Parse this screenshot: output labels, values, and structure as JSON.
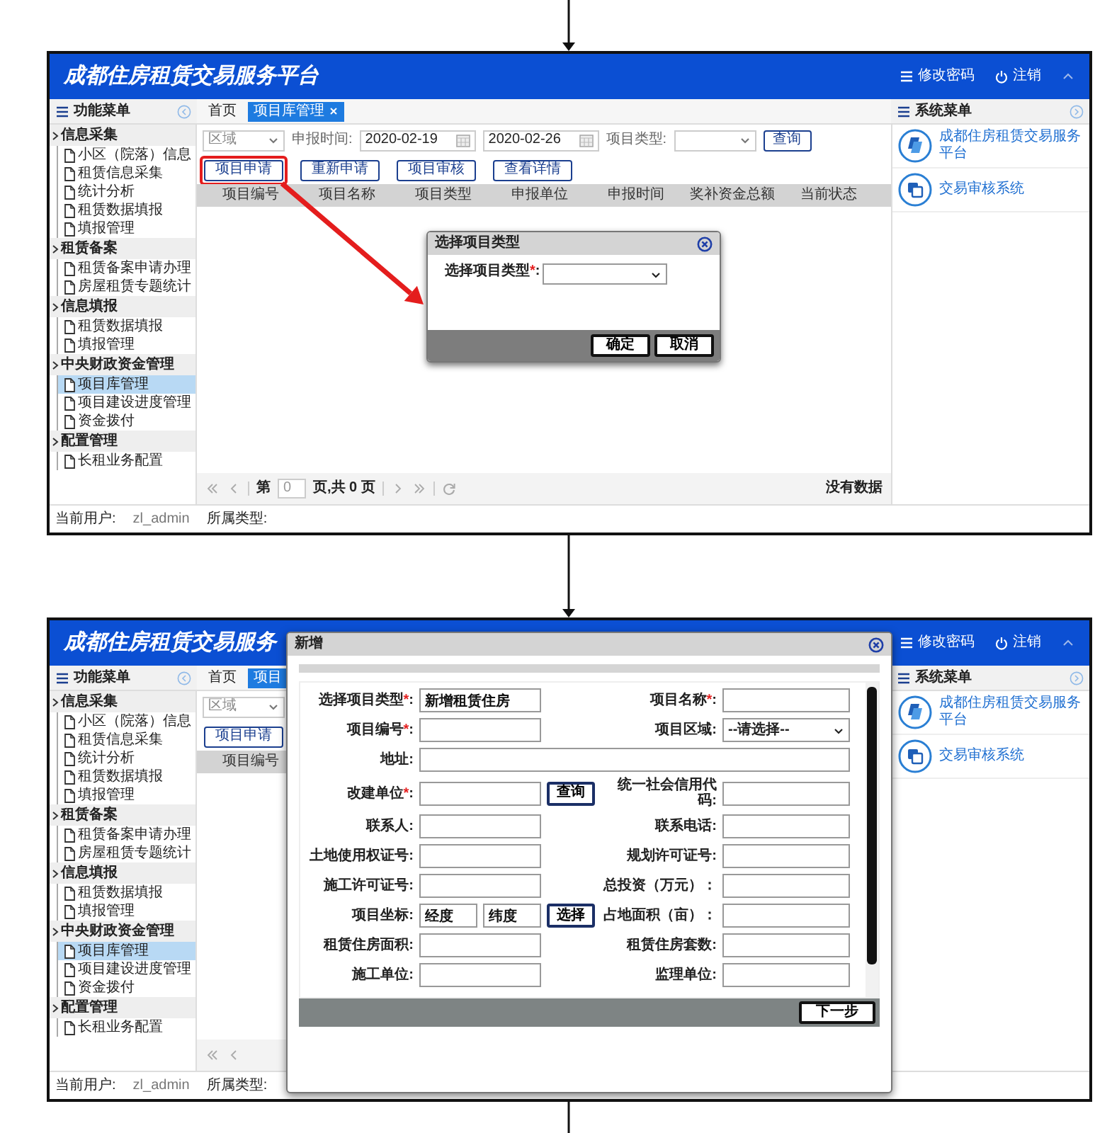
{
  "screens": [
    {
      "header": {
        "title": "成都住房租赁交易服务平台",
        "links": [
          {
            "kind": "password",
            "label": "修改密码"
          },
          {
            "kind": "logout",
            "label": "注销"
          }
        ]
      },
      "function_menu": {
        "title": "功能菜单"
      },
      "tabs": [
        {
          "label": "首页",
          "selected": false
        },
        {
          "label": "项目库管理",
          "selected": true,
          "closable": true
        }
      ],
      "system_menu": {
        "title": "系统菜单",
        "items": [
          {
            "kind": "platform",
            "label": "成都住房租赁交易服务平台"
          },
          {
            "kind": "review",
            "label": "交易审核系统"
          }
        ]
      },
      "sidebar": [
        {
          "label": "信息采集",
          "children": [
            {
              "label": "小区（院落）信息",
              "selected": false
            },
            {
              "label": "租赁信息采集",
              "selected": false
            },
            {
              "label": "统计分析",
              "selected": false
            },
            {
              "label": "租赁数据填报",
              "selected": false
            },
            {
              "label": "填报管理",
              "selected": false
            }
          ]
        },
        {
          "label": "租赁备案",
          "children": [
            {
              "label": "租赁备案申请办理",
              "selected": false
            },
            {
              "label": "房屋租赁专题统计",
              "selected": false
            }
          ]
        },
        {
          "label": "信息填报",
          "children": [
            {
              "label": "租赁数据填报",
              "selected": false
            },
            {
              "label": "填报管理",
              "selected": false
            }
          ]
        },
        {
          "label": "中央财政资金管理",
          "children": [
            {
              "label": "项目库管理",
              "selected": true
            },
            {
              "label": "项目建设进度管理",
              "selected": false
            },
            {
              "label": "资金拨付",
              "selected": false
            }
          ]
        },
        {
          "label": "配置管理",
          "children": [
            {
              "label": "长租业务配置",
              "selected": false
            }
          ]
        }
      ],
      "filters": [
        {
          "kind": "select",
          "placeholder": "区域"
        },
        {
          "kind": "label",
          "text": "申报时间:"
        },
        {
          "kind": "date",
          "value": "2020-02-19"
        },
        {
          "kind": "date",
          "value": "2020-02-26"
        },
        {
          "kind": "label",
          "text": "项目类型:"
        },
        {
          "kind": "select"
        },
        {
          "kind": "button",
          "text": "查询"
        }
      ],
      "actions": [
        {
          "label": "项目申请",
          "highlighted": true
        },
        {
          "label": "重新申请",
          "highlighted": false
        },
        {
          "label": "项目审核",
          "highlighted": false
        },
        {
          "label": "查看详情",
          "highlighted": false
        }
      ],
      "table": {
        "columns": [
          "项目编号",
          "项目名称",
          "项目类型",
          "申报单位",
          "申报时间",
          "奖补资金总额",
          "当前状态"
        ]
      },
      "pager": {
        "page_label": "第",
        "page": "0",
        "total": "页,共 0 页",
        "message": "没有数据"
      },
      "status_bar": {
        "user_label": "当前用户:",
        "user": "zl_admin",
        "type_label": "所属类型:"
      },
      "dialog": {
        "kind": "choice",
        "title": "选择项目类型",
        "label": "选择项目类型",
        "required_mark": "*",
        "label_end": ":",
        "buttons": [
          "确定",
          "取消"
        ]
      }
    },
    {
      "header": {
        "title": "成都住房租赁交易服务",
        "links": [
          {
            "kind": "password",
            "label": "修改密码"
          },
          {
            "kind": "logout",
            "label": "注销"
          }
        ]
      },
      "function_menu": {
        "title": "功能菜单"
      },
      "tabs": [
        {
          "label": "首页",
          "selected": false
        },
        {
          "label": "项目",
          "selected": true
        }
      ],
      "system_menu": {
        "title": "系统菜单",
        "items": [
          {
            "kind": "platform",
            "label": "成都住房租赁交易服务平台"
          },
          {
            "kind": "review",
            "label": "交易审核系统"
          }
        ]
      },
      "sidebar": [
        {
          "label": "信息采集",
          "children": [
            {
              "label": "小区（院落）信息",
              "selected": false
            },
            {
              "label": "租赁信息采集",
              "selected": false
            },
            {
              "label": "统计分析",
              "selected": false
            },
            {
              "label": "租赁数据填报",
              "selected": false
            },
            {
              "label": "填报管理",
              "selected": false
            }
          ]
        },
        {
          "label": "租赁备案",
          "children": [
            {
              "label": "租赁备案申请办理",
              "selected": false
            },
            {
              "label": "房屋租赁专题统计",
              "selected": false
            }
          ]
        },
        {
          "label": "信息填报",
          "children": [
            {
              "label": "租赁数据填报",
              "selected": false
            },
            {
              "label": "填报管理",
              "selected": false
            }
          ]
        },
        {
          "label": "中央财政资金管理",
          "children": [
            {
              "label": "项目库管理",
              "selected": true
            },
            {
              "label": "项目建设进度管理",
              "selected": false
            },
            {
              "label": "资金拨付",
              "selected": false
            }
          ]
        },
        {
          "label": "配置管理",
          "children": [
            {
              "label": "长租业务配置",
              "selected": false
            }
          ]
        }
      ],
      "filters": [
        {
          "kind": "select",
          "placeholder": "区域"
        }
      ],
      "actions": [
        {
          "label": "项目申请",
          "highlighted": false
        }
      ],
      "table": {
        "columns": [
          "项目编号"
        ]
      },
      "status_bar": {
        "user_label": "当前用户:",
        "user": "zl_admin",
        "type_label": "所属类型:"
      },
      "dialog": {
        "kind": "form",
        "title": "新增",
        "buttons": [
          "下一步"
        ],
        "rows": [
          [
            {
              "kind": "text",
              "label": "选择项目类型",
              "required_mark": "*",
              "label_end": ":",
              "value": "新增租赁住房"
            },
            {
              "kind": "text",
              "label": "项目名称",
              "required_mark": "*",
              "label_end": ":"
            }
          ],
          [
            {
              "kind": "text",
              "label": "项目编号",
              "required_mark": "*",
              "label_end": ":"
            },
            {
              "kind": "select",
              "label": "项目区域",
              "label_end": ":",
              "value": "--请选择--"
            }
          ],
          [
            {
              "kind": "wide",
              "label": "地址",
              "label_end": ":"
            }
          ],
          [
            {
              "kind": "lookup",
              "label": "改建单位",
              "required_mark": "*",
              "label_end": ":",
              "button": "查询"
            },
            {
              "kind": "text",
              "label": "统一社会信用代码",
              "label_end": ":"
            }
          ],
          [
            {
              "kind": "text",
              "label": "联系人",
              "label_end": ":"
            },
            {
              "kind": "text",
              "label": "联系电话",
              "label_end": ":"
            }
          ],
          [
            {
              "kind": "text",
              "label": "土地使用权证号",
              "label_end": ":"
            },
            {
              "kind": "text",
              "label": "规划许可证号",
              "label_end": ":"
            }
          ],
          [
            {
              "kind": "text",
              "label": "施工许可证号",
              "label_end": ":"
            },
            {
              "kind": "text",
              "label": "总投资（万元）",
              "label_end": "："
            }
          ],
          [
            {
              "kind": "coordinates",
              "label": "项目坐标",
              "label_end": ":",
              "values": [
                "经度",
                "纬度"
              ],
              "button": "选择"
            },
            {
              "kind": "text",
              "label": "占地面积（亩）",
              "label_end": "："
            }
          ],
          [
            {
              "kind": "text",
              "label": "租赁住房面积",
              "label_end": ":"
            },
            {
              "kind": "text",
              "label": "租赁住房套数",
              "label_end": ":"
            }
          ],
          [
            {
              "kind": "text",
              "label": "施工单位",
              "label_end": ":"
            },
            {
              "kind": "text",
              "label": "监理单位",
              "label_end": ":"
            }
          ]
        ]
      }
    }
  ]
}
